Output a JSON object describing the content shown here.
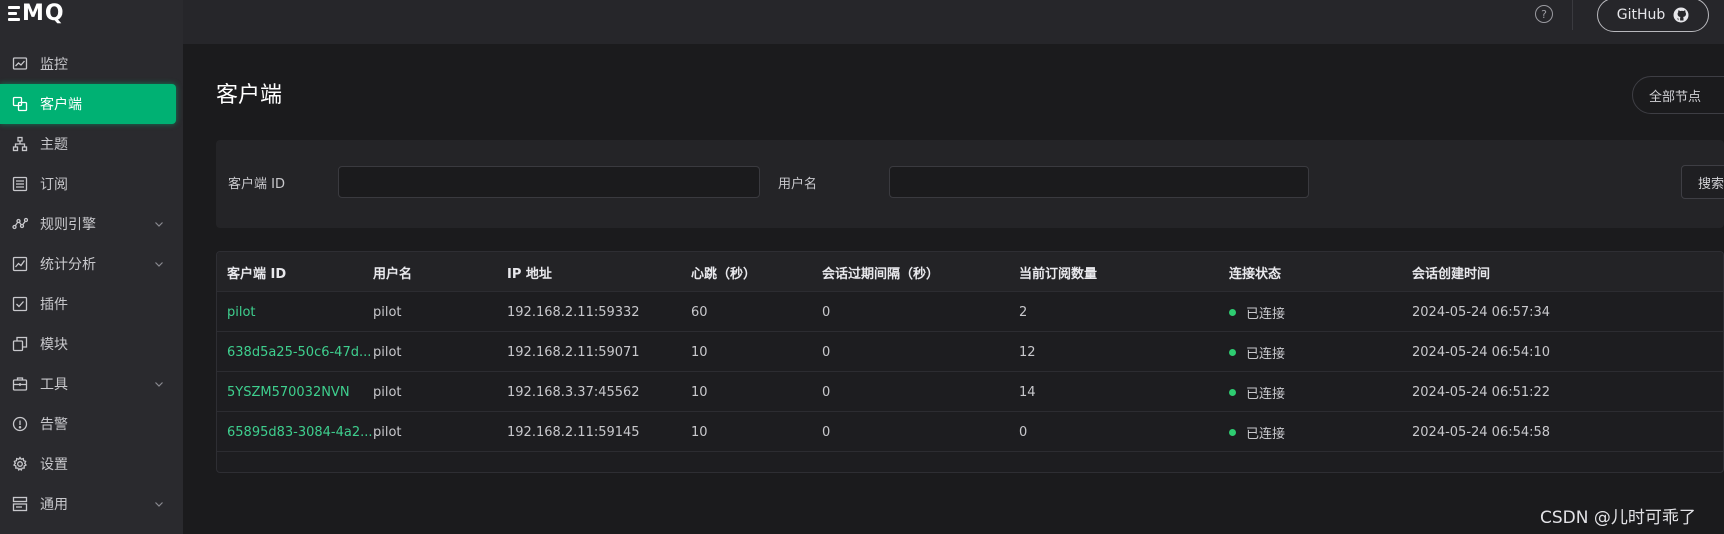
{
  "brand": {
    "logo_text": "MQ"
  },
  "sidebar": {
    "items": [
      {
        "label": "监控",
        "icon": "monitor-chart-icon",
        "active": false,
        "expandable": false
      },
      {
        "label": "客户端",
        "icon": "clients-icon",
        "active": true,
        "expandable": false
      },
      {
        "label": "主题",
        "icon": "topic-tree-icon",
        "active": false,
        "expandable": false
      },
      {
        "label": "订阅",
        "icon": "subscription-list-icon",
        "active": false,
        "expandable": false
      },
      {
        "label": "规则引擎",
        "icon": "rule-engine-icon",
        "active": false,
        "expandable": true
      },
      {
        "label": "统计分析",
        "icon": "analytics-icon",
        "active": false,
        "expandable": true
      },
      {
        "label": "插件",
        "icon": "plugin-check-icon",
        "active": false,
        "expandable": false
      },
      {
        "label": "模块",
        "icon": "module-copy-icon",
        "active": false,
        "expandable": false
      },
      {
        "label": "工具",
        "icon": "toolbox-icon",
        "active": false,
        "expandable": true
      },
      {
        "label": "告警",
        "icon": "alert-icon",
        "active": false,
        "expandable": false
      },
      {
        "label": "设置",
        "icon": "gear-icon",
        "active": false,
        "expandable": false
      },
      {
        "label": "通用",
        "icon": "general-icon",
        "active": false,
        "expandable": true
      }
    ]
  },
  "header": {
    "help_glyph": "?",
    "github_label": "GitHub"
  },
  "page": {
    "title": "客户端",
    "node_select_value": "全部节点"
  },
  "filters": {
    "client_id_label": "客户端 ID",
    "client_id_value": "",
    "username_label": "用户名",
    "username_value": "",
    "search_label": "搜索"
  },
  "table": {
    "columns": [
      "客户端 ID",
      "用户名",
      "IP 地址",
      "心跳（秒）",
      "会话过期间隔（秒）",
      "当前订阅数量",
      "连接状态",
      "会话创建时间"
    ],
    "rows": [
      {
        "client_id": "pilot",
        "username": "pilot",
        "ip": "192.168.2.11:59332",
        "keepalive": "60",
        "expiry": "0",
        "subs": "2",
        "status": "已连接",
        "created": "2024-05-24 06:57:34"
      },
      {
        "client_id": "638d5a25-50c6-47d...",
        "username": "pilot",
        "ip": "192.168.2.11:59071",
        "keepalive": "10",
        "expiry": "0",
        "subs": "12",
        "status": "已连接",
        "created": "2024-05-24 06:54:10"
      },
      {
        "client_id": "5YSZM570032NVN",
        "username": "pilot",
        "ip": "192.168.3.37:45562",
        "keepalive": "10",
        "expiry": "0",
        "subs": "14",
        "status": "已连接",
        "created": "2024-05-24 06:51:22"
      },
      {
        "client_id": "65895d83-3084-4a2...",
        "username": "pilot",
        "ip": "192.168.2.11:59145",
        "keepalive": "10",
        "expiry": "0",
        "subs": "0",
        "status": "已连接",
        "created": "2024-05-24 06:54:58"
      }
    ]
  },
  "watermark": "CSDN @儿时可乖了",
  "colors": {
    "accent": "#00b173",
    "link": "#3ecf8e",
    "status_dot": "#2ecc71",
    "sidebar_bg": "#2a2a2e",
    "page_bg": "#1b1b1d"
  }
}
